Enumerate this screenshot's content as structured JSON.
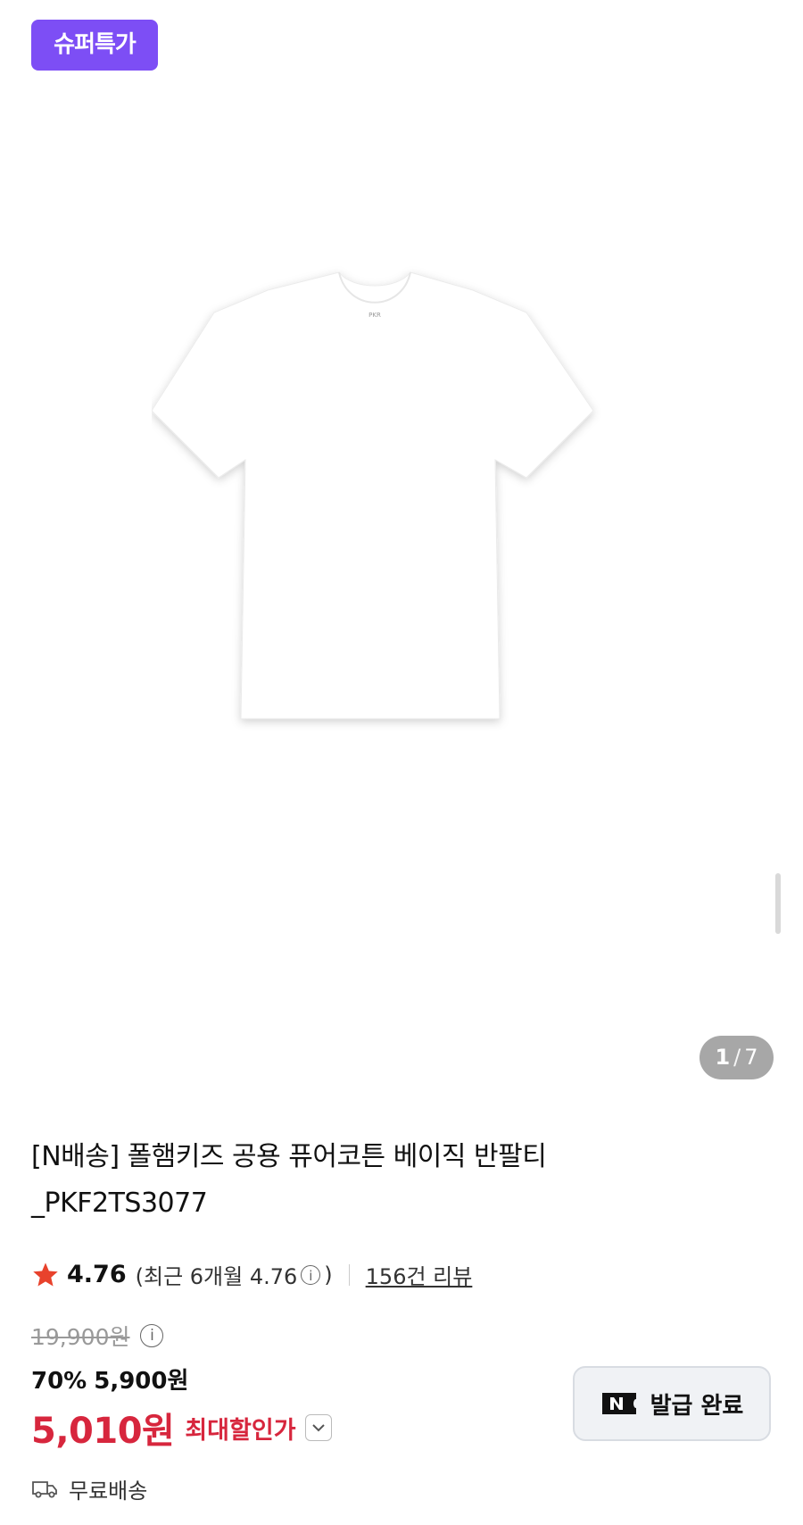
{
  "gallery": {
    "badge": "슈퍼특가",
    "current_image": "1",
    "separator": "/",
    "total_images": "7",
    "image_icon": "tshirt-image"
  },
  "product": {
    "title_line1": "[N배송] 폴햄키즈 공용 퓨어코튼 베이직 반팔티",
    "title_line2": "_PKF2TS3077"
  },
  "rating": {
    "star_icon": "star-icon",
    "value": "4.76",
    "recent_prefix": "(최근 6개월 4.76",
    "recent_suffix": ")",
    "reviews": "156건 리뷰"
  },
  "price": {
    "original": "19,900원",
    "discount_rate": "70%",
    "discount_price": "5,900원",
    "max_price": "5,010원",
    "max_label": "최대할인가"
  },
  "coupon": {
    "label": "발급 완료"
  },
  "shipping": {
    "label": "무료배송"
  },
  "colors": {
    "badge": "#7d4ef5",
    "sale_red": "#d7263d",
    "star": "#e8422c"
  }
}
